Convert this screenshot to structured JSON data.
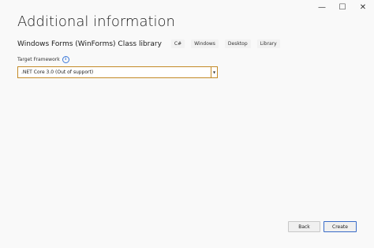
{
  "window_controls": {
    "minimize": "—",
    "maximize": "☐",
    "close": "✕"
  },
  "title": "Additional information",
  "template": {
    "name": "Windows Forms (WinForms) Class library",
    "tags": [
      "C#",
      "Windows",
      "Desktop",
      "Library"
    ]
  },
  "target_framework": {
    "label": "Target Framework",
    "info_glyph": "i",
    "selected": ".NET Core 3.0 (Out of support)",
    "arrow_glyph": "▼"
  },
  "buttons": {
    "back": "Back",
    "create": "Create"
  },
  "colors": {
    "accent": "#3a6cc8",
    "select_border": "#c48a27",
    "background": "#f9f9f9"
  }
}
